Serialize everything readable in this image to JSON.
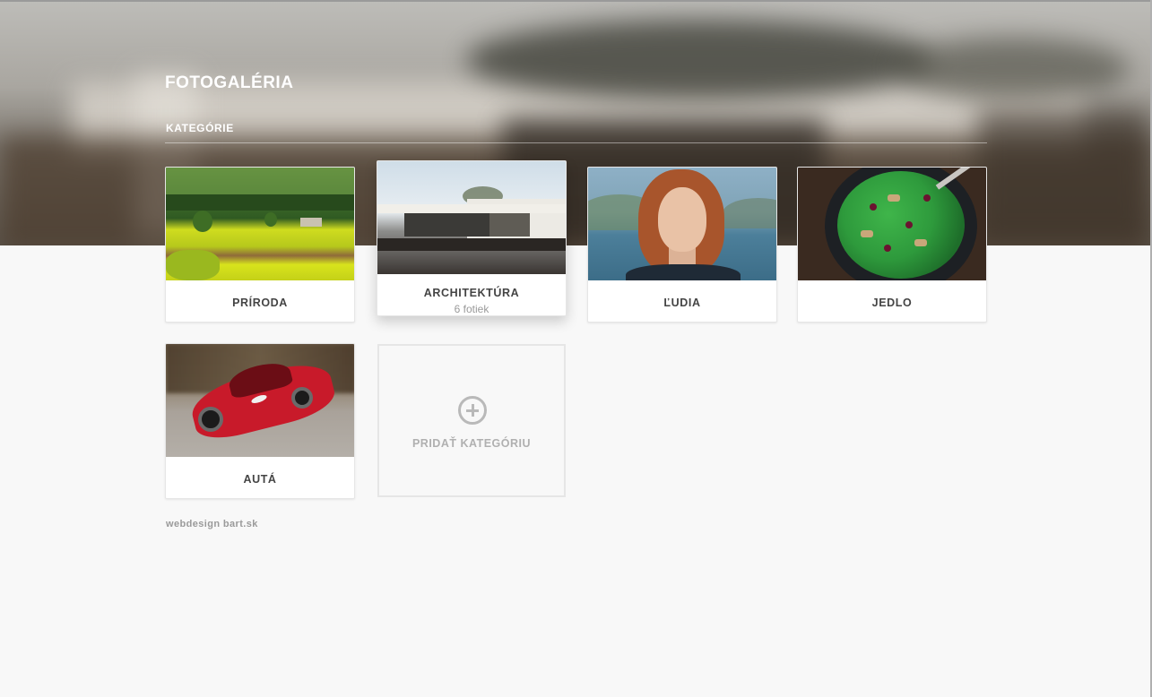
{
  "header": {
    "title": "FOTOGALÉRIA"
  },
  "section": {
    "title": "KATEGÓRIE"
  },
  "categories": [
    {
      "label": "PRÍRODA",
      "image": "nature-field-photo"
    },
    {
      "label": "ARCHITEKTÚRA",
      "sublabel": "6 fotiek",
      "image": "modern-house-photo",
      "state": "hover"
    },
    {
      "label": "ĽUDIA",
      "image": "portrait-woman-photo"
    },
    {
      "label": "JEDLO",
      "image": "salad-bowl-photo"
    },
    {
      "label": "AUTÁ",
      "image": "red-sports-car-photo"
    }
  ],
  "add_category": {
    "label": "PRIDAŤ KATEGÓRIU",
    "icon": "plus-circle-icon"
  },
  "footer": {
    "text": "webdesign bart.sk"
  }
}
